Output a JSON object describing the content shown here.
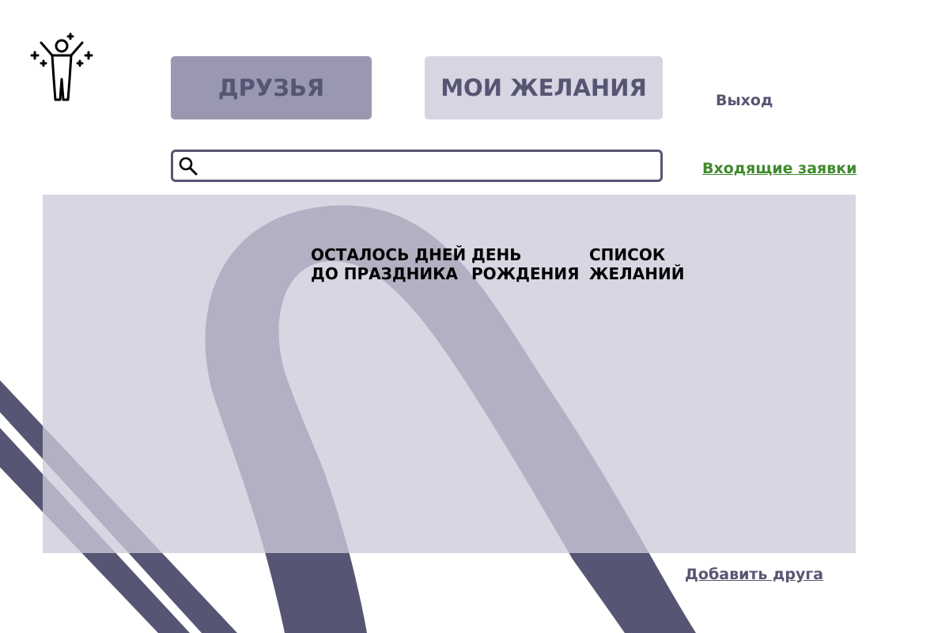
{
  "colors": {
    "accent": "#565573",
    "tab_active_bg": "#9a98b0",
    "tab_inactive_bg": "#d7d5e2",
    "panel_bg": "#cccada",
    "link_green": "#3f8a2d"
  },
  "header": {
    "logo_icon": "celebrating-person-icon",
    "tabs": [
      {
        "label": "ДРУЗЬЯ",
        "active": true
      },
      {
        "label": "МОИ ЖЕЛАНИЯ",
        "active": false
      }
    ],
    "logout_label": "Выход"
  },
  "search": {
    "icon": "search-icon",
    "value": "",
    "placeholder": ""
  },
  "incoming_requests_label": "Входящие заявки",
  "friends_table": {
    "columns": [
      {
        "line1": "ОСТАЛОСЬ ДНЕЙ",
        "line2": "ДО ПРАЗДНИКА"
      },
      {
        "line1": "ДЕНЬ",
        "line2": "РОЖДЕНИЯ"
      },
      {
        "line1": "СПИСОК",
        "line2": "ЖЕЛАНИЙ"
      }
    ],
    "rows": []
  },
  "add_friend_label": "Добавить друга"
}
